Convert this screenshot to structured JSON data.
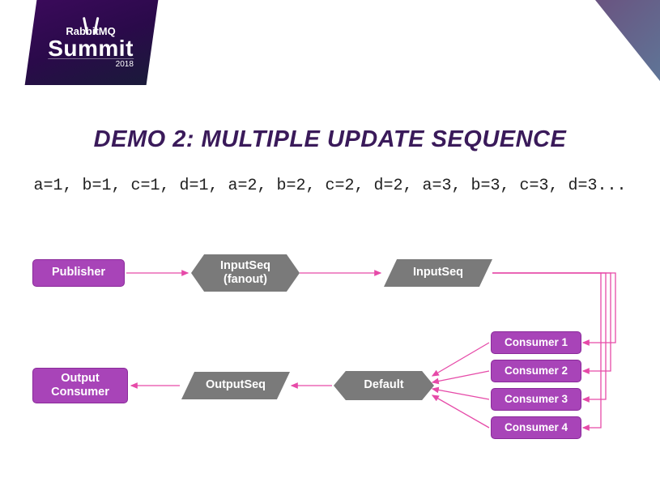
{
  "logo": {
    "brand": "RabbitMQ",
    "event": "Summit",
    "year": "2018"
  },
  "title": "DEMO 2: MULTIPLE UPDATE SEQUENCE",
  "sequence": "a=1, b=1, c=1, d=1, a=2, b=2, c=2, d=2, a=3, b=3, c=3, d=3...",
  "nodes": {
    "publisher": "Publisher",
    "inputseq_fanout": "InputSeq\n(fanout)",
    "inputseq": "InputSeq",
    "default": "Default",
    "outputseq": "OutputSeq",
    "output_consumer": "Output\nConsumer",
    "consumer1": "Consumer 1",
    "consumer2": "Consumer 2",
    "consumer3": "Consumer 3",
    "consumer4": "Consumer 4"
  }
}
